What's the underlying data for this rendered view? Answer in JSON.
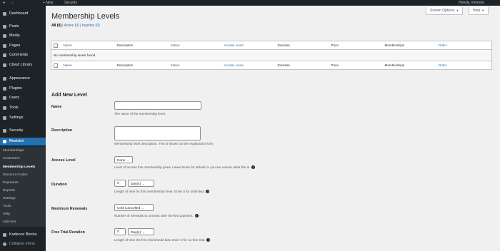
{
  "admin_bar": {
    "new_label": "+ New",
    "security_label": "Security",
    "howdy": "Howdy, mmoore"
  },
  "sidebar": {
    "items": [
      {
        "label": "Dashboard",
        "icon": "dashboard-icon"
      },
      {
        "label": "Posts",
        "icon": "pin-icon"
      },
      {
        "label": "Media",
        "icon": "media-icon"
      },
      {
        "label": "Pages",
        "icon": "page-icon"
      },
      {
        "label": "Comments",
        "icon": "comment-icon"
      },
      {
        "label": "Cloud Library",
        "icon": "cloud-icon"
      },
      {
        "label": "Appearance",
        "icon": "brush-icon"
      },
      {
        "label": "Plugins",
        "icon": "plug-icon"
      },
      {
        "label": "Users",
        "icon": "user-icon"
      },
      {
        "label": "Tools",
        "icon": "wrench-icon"
      },
      {
        "label": "Settings",
        "icon": "sliders-icon"
      },
      {
        "label": "Security",
        "icon": "shield-icon"
      },
      {
        "label": "Restrict",
        "icon": "lock-icon"
      }
    ],
    "submenu": [
      "Memberships",
      "Customers",
      "Membership Levels",
      "Discount Codes",
      "Payments",
      "Reports",
      "Settings",
      "Tools",
      "Help",
      "Add-ons"
    ],
    "bottom": [
      {
        "label": "Kadence Blocks",
        "icon": "kadence-icon"
      },
      {
        "label": "Collapse menu",
        "icon": "collapse-icon"
      }
    ]
  },
  "top_buttons": {
    "screen_options": "Screen Options",
    "help": "Help"
  },
  "page": {
    "title": "Membership Levels",
    "filters": {
      "all": "All (0)",
      "active": "Active (0)",
      "inactive": "Inactive (0)"
    }
  },
  "table": {
    "columns": [
      "Name",
      "Description",
      "Status",
      "Access Level",
      "Duration",
      "Price",
      "Memberships",
      "Order"
    ],
    "empty_message": "No membership levels found."
  },
  "form": {
    "heading": "Add New Level",
    "name": {
      "label": "Name",
      "value": "",
      "desc": "The name of the membership level."
    },
    "description": {
      "label": "Description",
      "value": "",
      "desc": "Membership level description. This is shown on the registration form."
    },
    "access_level": {
      "label": "Access Level",
      "value": "None",
      "desc": "Level of access this membership gives. Leave None for default or you are unsure what this is."
    },
    "duration": {
      "label": "Duration",
      "value": "0",
      "unit": "Day(s)",
      "desc": "Length of time for this membership level. Enter 0 for unlimited."
    },
    "max_renewals": {
      "label": "Maximum Renewals",
      "value": "Until Cancelled",
      "desc": "Number of renewals to process after the first payment."
    },
    "free_trial": {
      "label": "Free Trial Duration",
      "value": "0",
      "unit": "Day(s)",
      "desc": "Length of time the free trial should last. Enter 0 for no free trial."
    }
  }
}
